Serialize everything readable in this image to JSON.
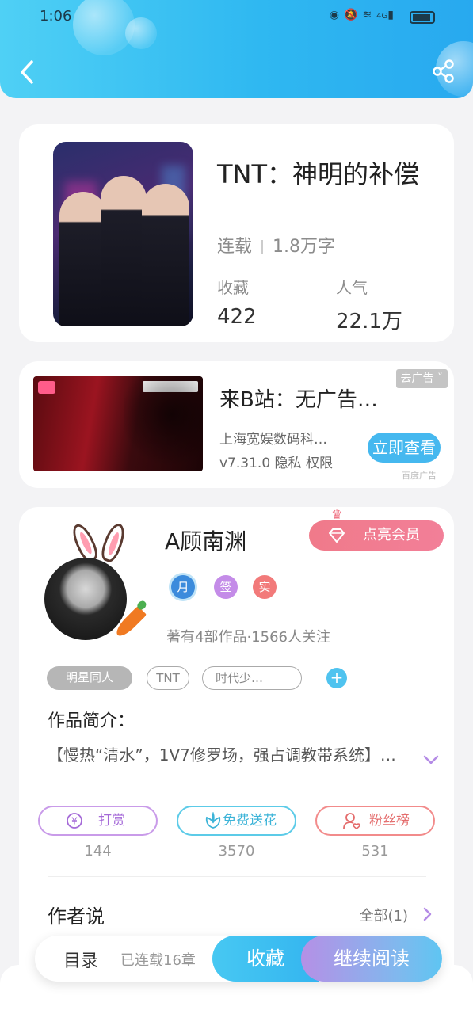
{
  "status_bar": {
    "time": "1:06",
    "network": "4G"
  },
  "book": {
    "title": "TNT：神明的补偿",
    "status": "连载",
    "word_count": "1.8万字",
    "stats": [
      {
        "label": "收藏",
        "value": "422"
      },
      {
        "label": "人气",
        "value": "22.1万"
      }
    ]
  },
  "ad": {
    "close_label": "去广告",
    "title": "来B站：无广告…",
    "company": "上海宽娱数码科…",
    "version_line": "v7.31.0  隐私  权限",
    "cta": "立即查看",
    "tag": "百度广告"
  },
  "author": {
    "name": "A顾南渊",
    "vip_label": "点亮会员",
    "badges": [
      "月",
      "签",
      "实"
    ],
    "stats_line": "著有4部作品·1566人关注",
    "tags": [
      "明星同人",
      "TNT",
      "时代少…"
    ],
    "intro_title": "作品简介：",
    "intro_text": "【慢热“清水”，1V7修罗场，强占调教带系统】…",
    "actions": [
      {
        "label": "打赏",
        "count": "144",
        "icon": "yen-icon"
      },
      {
        "label": "免费送花",
        "count": "3570",
        "icon": "flower-icon"
      },
      {
        "label": "粉丝榜",
        "count": "531",
        "icon": "fans-icon"
      }
    ],
    "saying_title": "作者说",
    "saying_all": "全部(1)"
  },
  "bottom_bar": {
    "toc_label": "目录",
    "toc_count": "已连载16章",
    "collect_label": "收藏",
    "read_label": "继续阅读"
  },
  "colors": {
    "header_accent": "#2fb8f1",
    "vip_pink": "#f07a8a",
    "reward_purple": "#a56ad8",
    "flower_cyan": "#3db4d8",
    "fans_red": "#e46c6c"
  }
}
